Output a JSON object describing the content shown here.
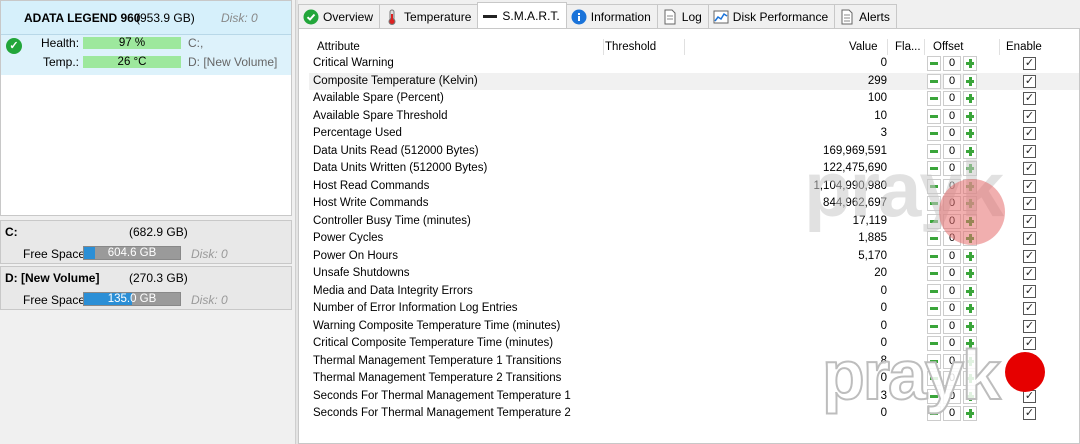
{
  "disk": {
    "name": "ADATA LEGEND 960",
    "size": "(953.9 GB)",
    "disk_num": "Disk: 0",
    "health_label": "Health:",
    "health_value": "97 %",
    "temp_label": "Temp.:",
    "temp_value": "26 °C",
    "vol1": "C:,",
    "vol2": "D: [New Volume]"
  },
  "volumes": [
    {
      "title": "C:",
      "size": "(682.9 GB)",
      "free_label": "Free Space",
      "free_value": "604.6 GB",
      "disk": "Disk: 0",
      "used_fraction": 0.11
    },
    {
      "title": "D: [New Volume]",
      "size": "(270.3 GB)",
      "free_label": "Free Space",
      "free_value": "135.0 GB",
      "disk": "Disk: 0",
      "used_fraction": 0.5
    }
  ],
  "tabs": [
    {
      "label": "Overview",
      "icon": "check-circle-icon"
    },
    {
      "label": "Temperature",
      "icon": "thermometer-icon"
    },
    {
      "label": "S.M.A.R.T.",
      "icon": "smart-dash-icon"
    },
    {
      "label": "Information",
      "icon": "info-icon"
    },
    {
      "label": "Log",
      "icon": "log-document-icon"
    },
    {
      "label": "Disk Performance",
      "icon": "performance-chart-icon"
    },
    {
      "label": "Alerts",
      "icon": "alerts-document-icon"
    }
  ],
  "table": {
    "headers": {
      "attribute": "Attribute",
      "threshold": "Threshold",
      "value": "Value",
      "flags": "Fla...",
      "offset": "Offset",
      "enable": "Enable"
    },
    "rows": [
      {
        "attr": "Critical Warning",
        "value": "0",
        "offset": "0"
      },
      {
        "attr": "Composite Temperature (Kelvin)",
        "value": "299",
        "offset": "0"
      },
      {
        "attr": "Available Spare (Percent)",
        "value": "100",
        "offset": "0"
      },
      {
        "attr": "Available Spare Threshold",
        "value": "10",
        "offset": "0"
      },
      {
        "attr": "Percentage Used",
        "value": "3",
        "offset": "0"
      },
      {
        "attr": "Data Units Read (512000 Bytes)",
        "value": "169,969,591",
        "offset": "0"
      },
      {
        "attr": "Data Units Written (512000 Bytes)",
        "value": "122,475,690",
        "offset": "0"
      },
      {
        "attr": "Host Read Commands",
        "value": "1,104,990,980",
        "offset": "0"
      },
      {
        "attr": "Host Write Commands",
        "value": "844,962,697",
        "offset": "0"
      },
      {
        "attr": "Controller Busy Time (minutes)",
        "value": "17,119",
        "offset": "0"
      },
      {
        "attr": "Power Cycles",
        "value": "1,885",
        "offset": "0"
      },
      {
        "attr": "Power On Hours",
        "value": "5,170",
        "offset": "0"
      },
      {
        "attr": "Unsafe Shutdowns",
        "value": "20",
        "offset": "0"
      },
      {
        "attr": "Media and Data Integrity Errors",
        "value": "0",
        "offset": "0"
      },
      {
        "attr": "Number of Error Information Log Entries",
        "value": "0",
        "offset": "0"
      },
      {
        "attr": "Warning Composite Temperature Time (minutes)",
        "value": "0",
        "offset": "0"
      },
      {
        "attr": "Critical Composite Temperature Time (minutes)",
        "value": "0",
        "offset": "0"
      },
      {
        "attr": "Thermal Management Temperature 1 Transitions",
        "value": "8",
        "offset": "0"
      },
      {
        "attr": "Thermal Management Temperature 2 Transitions",
        "value": "0",
        "offset": "0"
      },
      {
        "attr": "Seconds For Thermal Management Temperature 1",
        "value": "3",
        "offset": "0"
      },
      {
        "attr": "Seconds For Thermal Management Temperature 2",
        "value": "0",
        "offset": "0"
      }
    ]
  },
  "watermark": {
    "text": "prayk"
  },
  "colors": {
    "health_bar": "#9de89d",
    "free_space_bar": "#2b8fd6",
    "accent_green": "#22a63a",
    "header_bg": "#d6f0fb"
  }
}
